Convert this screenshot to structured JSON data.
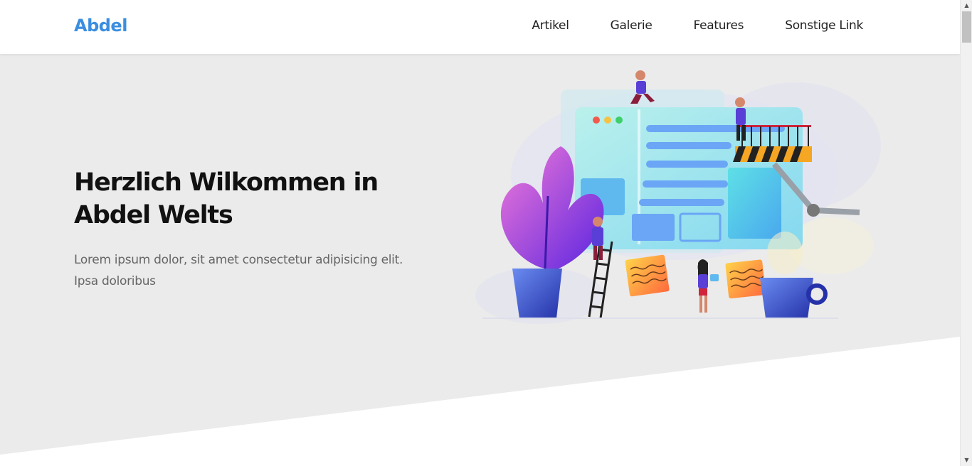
{
  "navbar": {
    "brand": "Abdel",
    "links": [
      "Artikel",
      "Galerie",
      "Features",
      "Sonstige Link"
    ]
  },
  "hero": {
    "title": "Herzlich Wilkommen in Abdel Welts",
    "text": "Lorem ipsum dolor, sit amet consectetur adipisicing elit. Ipsa doloribus"
  },
  "colors": {
    "brand": "#3a8ee0",
    "hero_background": "#ebebeb",
    "heading": "#111111",
    "body_text": "#666666"
  },
  "icons": {
    "scroll_up": "▲",
    "scroll_down": "▼"
  }
}
